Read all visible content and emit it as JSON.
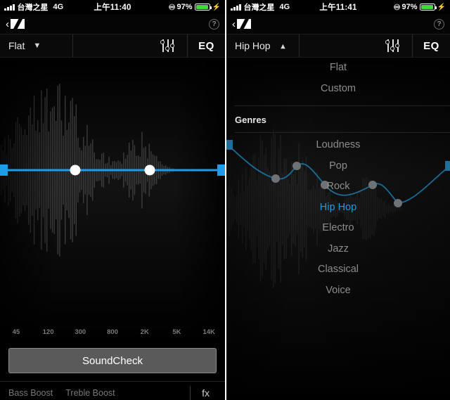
{
  "left": {
    "statusbar": {
      "signal_icon": "signal-bars-icon",
      "carrier": "台灣之星",
      "network": "4G",
      "time": "上午11:40",
      "headphones_icon": "headphones-icon",
      "battery_pct": "97%",
      "charging_icon": "lightning-bolt-icon"
    },
    "navbar": {
      "back_icon": "back-chevron-icon",
      "logo": "sennheiser-logo-icon",
      "help_label": "?"
    },
    "toolbar": {
      "preset": "Flat",
      "chevron": "chevron-down-icon",
      "sliders_icon": "sliders-icon",
      "eq_label": "EQ"
    },
    "freq_labels": [
      "45",
      "120",
      "300",
      "800",
      "2K",
      "5K",
      "14K"
    ],
    "soundcheck_label": "SoundCheck",
    "footer": {
      "bass_boost": "Bass Boost",
      "treble_boost": "Treble Boost",
      "fx_label": "fx"
    }
  },
  "right": {
    "statusbar": {
      "signal_icon": "signal-bars-icon",
      "carrier": "台灣之星",
      "network": "4G",
      "time": "上午11:41",
      "headphones_icon": "headphones-icon",
      "battery_pct": "97%",
      "charging_icon": "lightning-bolt-icon"
    },
    "navbar": {
      "back_icon": "back-chevron-icon",
      "logo": "sennheiser-logo-icon",
      "help_label": "?"
    },
    "toolbar": {
      "preset": "Hip Hop",
      "chevron": "chevron-up-icon",
      "sliders_icon": "sliders-icon",
      "eq_label": "EQ"
    },
    "dropdown": {
      "top_items": [
        "Flat",
        "Custom"
      ],
      "group_label": "Genres",
      "genres": [
        "Loudness",
        "Pop",
        "Rock",
        "Hip Hop",
        "Electro",
        "Jazz",
        "Classical",
        "Voice"
      ],
      "selected": "Hip Hop"
    }
  },
  "colors": {
    "accent": "#1e9ce8",
    "curve_dim": "#1b6d99",
    "node": "#ffffff",
    "node_dim": "#6e7276",
    "battery_green": "#3ddc3d",
    "text_dim": "#8d8d8d",
    "background": "#000000"
  },
  "chart_data": [
    {
      "type": "line",
      "title": "Flat EQ curve",
      "xlabel": "",
      "ylabel": "",
      "categories": [
        "45",
        "120",
        "300",
        "800",
        "2K",
        "5K",
        "14K"
      ],
      "x": [
        5,
        107,
        213,
        315
      ],
      "values": [
        0,
        0,
        0,
        0
      ],
      "ylim": [
        -12,
        12
      ],
      "grid": false,
      "legend": "none",
      "notes": "Horizontal flat line at 0 dB with two draggable round handles and square endpoints"
    },
    {
      "type": "line",
      "title": "Hip Hop EQ curve",
      "xlabel": "",
      "ylabel": "",
      "categories": [
        "45",
        "120",
        "300",
        "800",
        "2K",
        "5K",
        "14K"
      ],
      "x": [
        2,
        70,
        100,
        140,
        208,
        244,
        314
      ],
      "values": [
        7.5,
        -1.5,
        3.0,
        -7.0,
        -2.5,
        -8.5,
        3.0
      ],
      "ylim": [
        -12,
        12
      ],
      "grid": false,
      "legend": "none",
      "notes": "Curve drawn behind the translucent preset dropdown; endpoints are square, interior points are round grey handles"
    }
  ]
}
